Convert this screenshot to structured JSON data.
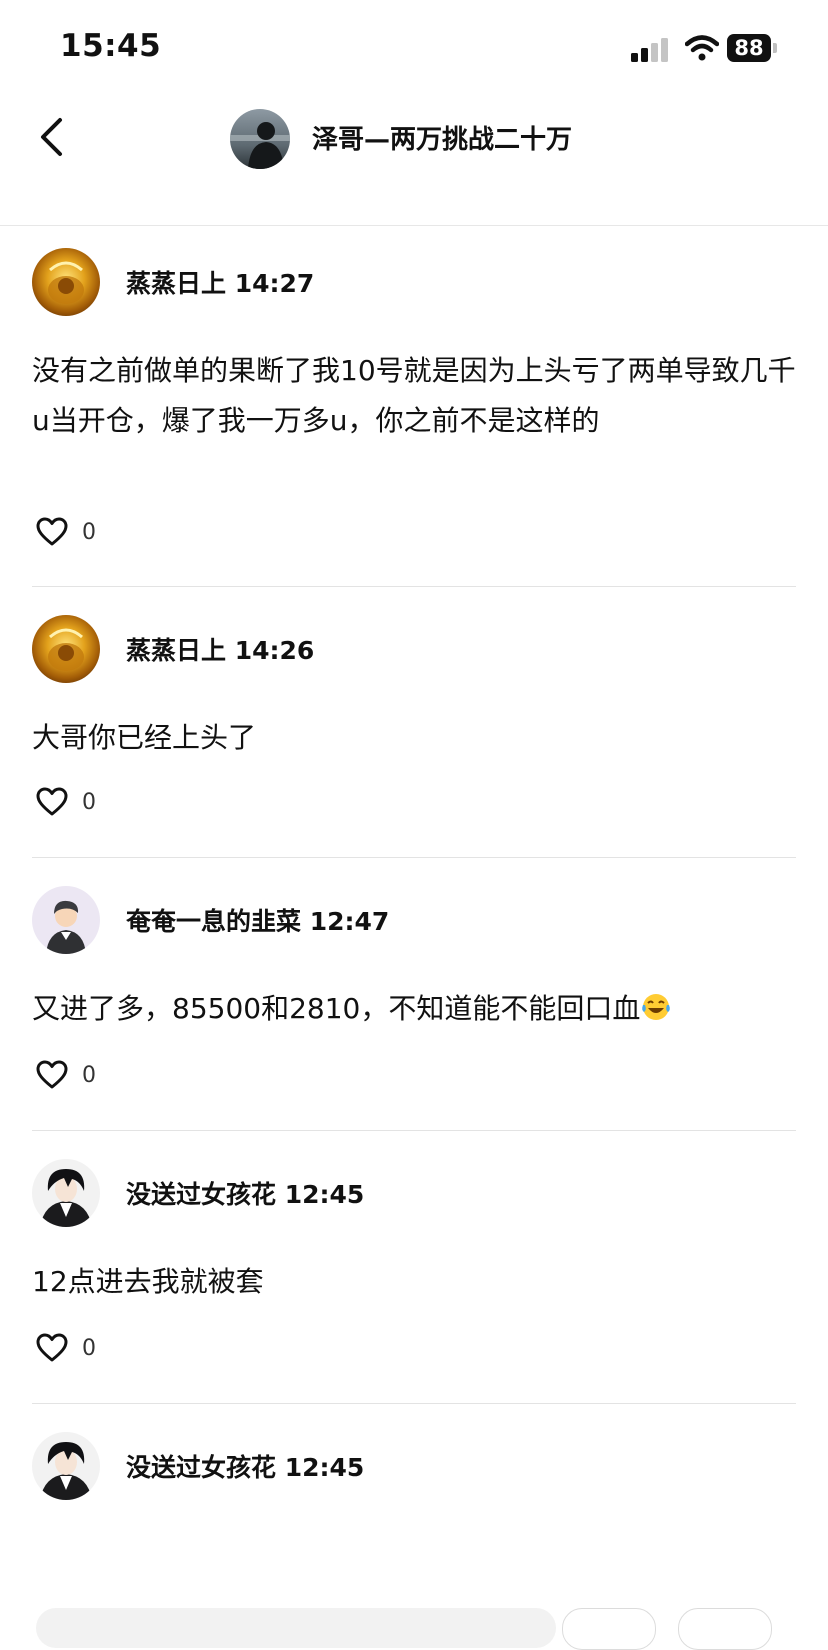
{
  "status_bar": {
    "time": "15:45",
    "battery": "88"
  },
  "header": {
    "title": "泽哥—两万挑战二十万"
  },
  "comments": [
    {
      "author": "蒸蒸日上",
      "time": "14:27",
      "text": "没有之前做单的果断了我10号就是因为上头亏了两单导致几千u当开仓，爆了我一万多u，你之前不是这样的",
      "likes": "0"
    },
    {
      "author": "蒸蒸日上",
      "time": "14:26",
      "text": "大哥你已经上头了",
      "likes": "0"
    },
    {
      "author": "奄奄一息的韭菜",
      "time": "12:47",
      "text": "又进了多，85500和2810，不知道能不能回口血",
      "likes": "0"
    },
    {
      "author": "没送过女孩花",
      "time": "12:45",
      "text": "12点进去我就被套",
      "likes": "0"
    },
    {
      "author": "没送过女孩花",
      "time": "12:45"
    }
  ]
}
